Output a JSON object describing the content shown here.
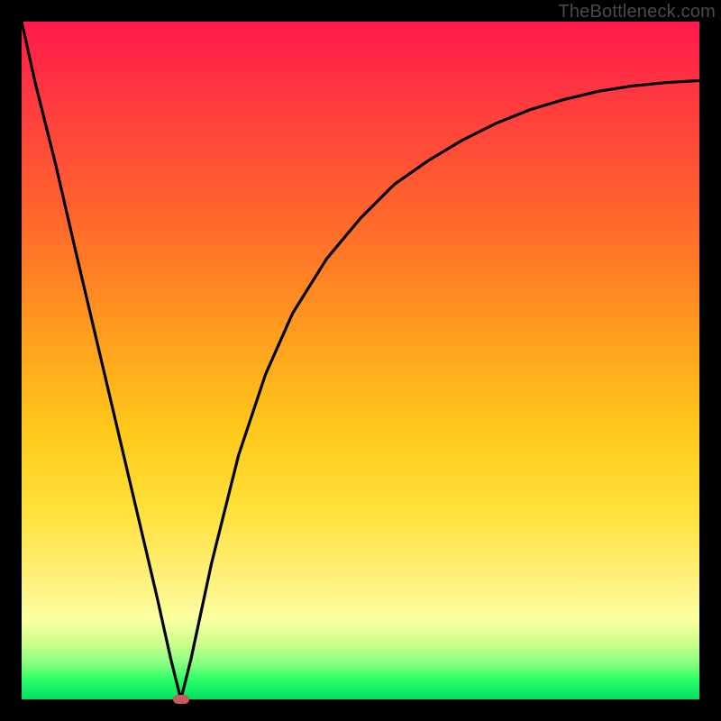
{
  "watermark": "TheBottleneck.com",
  "colors": {
    "frame": "#000000",
    "gradient_top": "#ff1a4d",
    "gradient_mid1": "#ff9a1f",
    "gradient_mid2": "#ffe13a",
    "gradient_bottom": "#00e060",
    "curve_stroke": "#000000",
    "marker_fill": "#c85a5a"
  },
  "chart_data": {
    "type": "line",
    "title": "",
    "xlabel": "",
    "ylabel": "",
    "xlim": [
      0,
      100
    ],
    "ylim": [
      0,
      100
    ],
    "x": [
      0,
      2,
      5,
      8,
      12,
      16,
      20,
      22,
      23.5,
      25,
      28,
      32,
      36,
      40,
      45,
      50,
      55,
      60,
      65,
      70,
      75,
      80,
      85,
      90,
      95,
      100
    ],
    "y": [
      100,
      91,
      79,
      66,
      49,
      32,
      15,
      6,
      0,
      6,
      20,
      36,
      48,
      57,
      65,
      71,
      76,
      79.5,
      82.5,
      85,
      87,
      88.5,
      89.7,
      90.5,
      91,
      91.3
    ],
    "minimum": {
      "x": 23.5,
      "y": 0
    },
    "annotations": []
  }
}
